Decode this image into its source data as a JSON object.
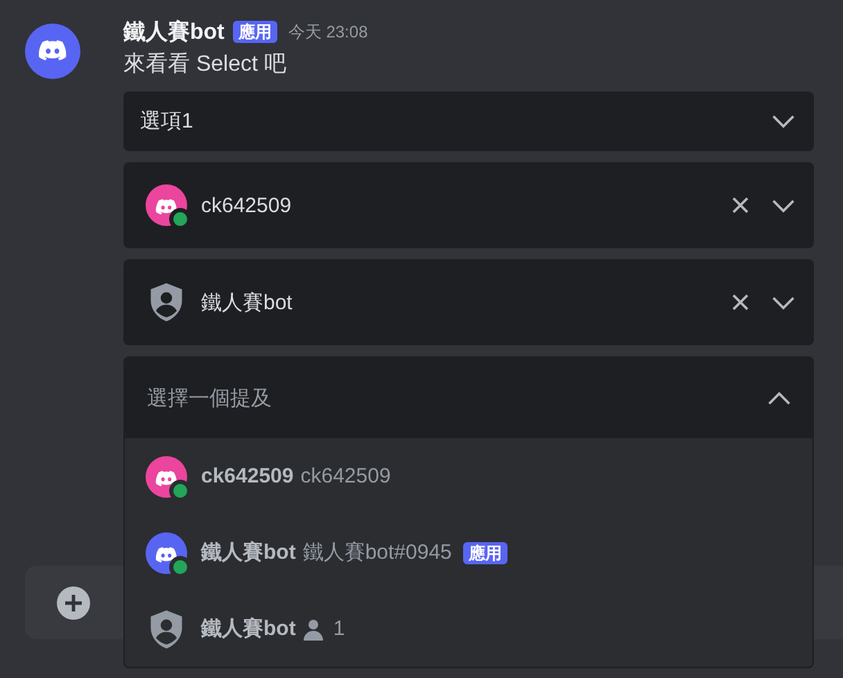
{
  "message": {
    "author": "鐵人賽bot",
    "tag": "應用",
    "time": "今天 23:08",
    "text": "來看看 Select 吧",
    "avatar": {
      "color": "#5865f2"
    }
  },
  "selects": [
    {
      "kind": "text",
      "value": "選項1",
      "clearable": false,
      "expanded": false
    },
    {
      "kind": "mention",
      "value": {
        "kind": "user",
        "color": "#eb459e",
        "online": true,
        "name": "ck642509"
      },
      "clearable": true,
      "expanded": false
    },
    {
      "kind": "mention",
      "value": {
        "kind": "role",
        "name": "鐵人賽bot"
      },
      "clearable": true,
      "expanded": false
    },
    {
      "kind": "placeholder",
      "placeholder": "選擇一個提及",
      "expanded": true,
      "options": [
        {
          "kind": "user",
          "color": "#eb459e",
          "online": true,
          "name": "ck642509",
          "detail": "ck642509"
        },
        {
          "kind": "user",
          "color": "#5865f2",
          "online": true,
          "name": "鐵人賽bot",
          "detail": "鐵人賽bot#0945",
          "tag": "應用"
        },
        {
          "kind": "role",
          "name": "鐵人賽bot",
          "count": "1"
        }
      ]
    }
  ]
}
